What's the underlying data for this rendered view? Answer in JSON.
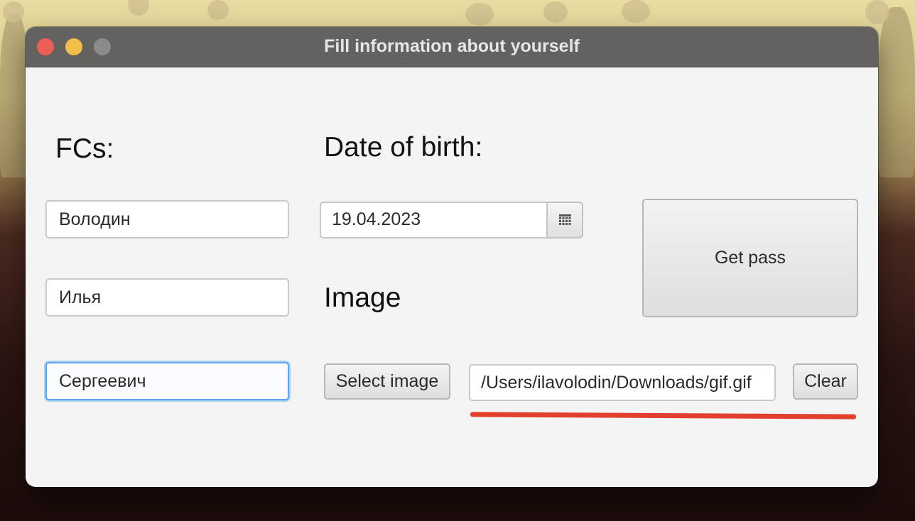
{
  "window": {
    "title": "Fill information about yourself"
  },
  "labels": {
    "fcs": "FCs:",
    "date_of_birth": "Date of birth:",
    "image": "Image"
  },
  "fields": {
    "last_name": "Володин",
    "first_name": "Илья",
    "patronymic": "Сергеевич",
    "date_of_birth": "19.04.2023",
    "image_path": "/Users/ilavolodin/Downloads/gif.gif"
  },
  "buttons": {
    "get_pass": "Get pass",
    "select_image": "Select image",
    "clear": "Clear"
  },
  "icons": {
    "calendar": "calendar-icon"
  },
  "colors": {
    "focus_ring": "#5fa4e8",
    "annotation_underline": "#e2402f",
    "traffic_close": "#ec5f57",
    "traffic_minimize": "#f3bf4b",
    "traffic_maximize": "#8c8b89"
  }
}
